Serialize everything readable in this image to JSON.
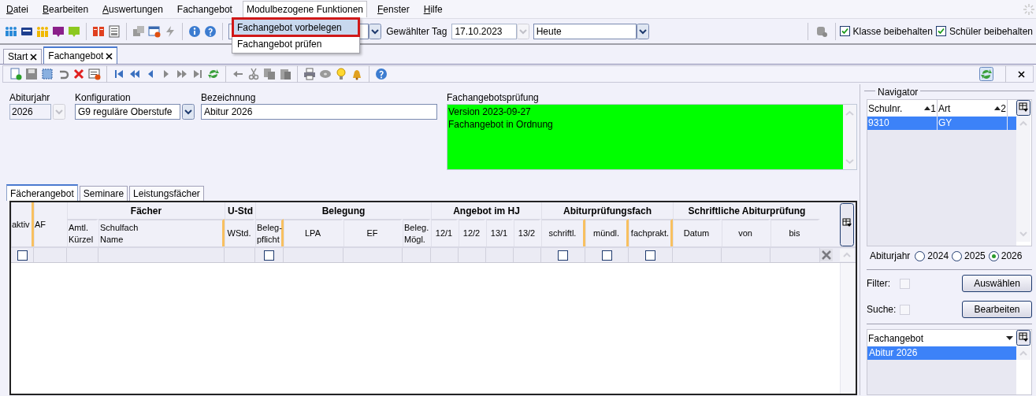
{
  "menu": [
    {
      "label": "Datei",
      "mnemonic": true,
      "selected": false
    },
    {
      "label": "Bearbeiten",
      "mnemonic": true,
      "selected": false
    },
    {
      "label": "Auswertungen",
      "mnemonic": true,
      "selected": false
    },
    {
      "label": "Fachangebot",
      "mnemonic": false,
      "selected": false
    },
    {
      "label": "Modulbezogene Funktionen",
      "mnemonic": false,
      "selected": true
    },
    {
      "label": "Fenster",
      "mnemonic": true,
      "selected": false
    },
    {
      "label": "Hilfe",
      "mnemonic": true,
      "selected": false
    }
  ],
  "dropdown": {
    "items": [
      {
        "label": "Fachangebot vorbelegen",
        "selected": true
      },
      {
        "label": "Fachangebot prüfen",
        "selected": false
      }
    ]
  },
  "toolbar": {
    "day_label": "Gewählter Tag",
    "day_value": "17.10.2023",
    "period_value": "Heute",
    "checkboxes": [
      {
        "label": "Klasse beibehalten",
        "checked": true
      },
      {
        "label": "Schüler beibehalten",
        "checked": true
      }
    ]
  },
  "tabs": [
    {
      "label": "Start",
      "selected": false
    },
    {
      "label": "Fachangebot",
      "selected": true
    }
  ],
  "form": {
    "fields": [
      {
        "label": "Abiturjahr",
        "value": "2026",
        "kind": "locked-combo"
      },
      {
        "label": "Konfiguration",
        "value": "G9 reguläre Oberstufe",
        "kind": "combo"
      },
      {
        "label": "Bezeichnung",
        "value": "Abitur 2026",
        "kind": "text"
      }
    ],
    "check": {
      "label": "Fachangebotsprüfung",
      "lines": [
        "Version 2023-09-27",
        "Fachangebot in Ordnung"
      ],
      "color": "#00ff00"
    }
  },
  "inner_tabs": [
    {
      "label": "Fächerangebot",
      "selected": true
    },
    {
      "label": "Seminare",
      "selected": false
    },
    {
      "label": "Leistungsfächer",
      "selected": false
    }
  ],
  "grid": {
    "header": [
      {
        "label": "aktiv",
        "marked": true,
        "filter_checkbox": true
      },
      {
        "label": "AF",
        "marked": false,
        "filter_checkbox": false
      },
      {
        "group": "Fächer",
        "columns": [
          {
            "label": "Amtl.\nKürzel",
            "marked": false,
            "filter_checkbox": false
          },
          {
            "label": "Schulfach\nName",
            "marked": true,
            "filter_checkbox": false
          }
        ]
      },
      {
        "group": "U-Std",
        "columns": [
          {
            "label": "WStd.",
            "marked": false,
            "filter_checkbox": false
          }
        ]
      },
      {
        "group": "Belegung",
        "columns": [
          {
            "label": "Beleg-\npflicht",
            "marked": true,
            "filter_checkbox": true
          },
          {
            "label": "LPA",
            "marked": false,
            "filter_checkbox": false
          },
          {
            "label": "EF",
            "marked": false,
            "filter_checkbox": false
          },
          {
            "label": "Beleg.\nMögl.",
            "marked": false,
            "filter_checkbox": false
          }
        ]
      },
      {
        "group": "Angebot im HJ",
        "columns": [
          {
            "label": "12/1",
            "marked": false,
            "filter_checkbox": false
          },
          {
            "label": "12/2",
            "marked": false,
            "filter_checkbox": false
          },
          {
            "label": "13/1",
            "marked": false,
            "filter_checkbox": false
          },
          {
            "label": "13/2",
            "marked": false,
            "filter_checkbox": false
          }
        ]
      },
      {
        "group": "Abiturprüfungsfach",
        "columns": [
          {
            "label": "schriftl.",
            "marked": true,
            "filter_checkbox": true
          },
          {
            "label": "mündl.",
            "marked": true,
            "filter_checkbox": true
          },
          {
            "label": "fachprakt.",
            "marked": true,
            "filter_checkbox": true
          }
        ]
      },
      {
        "group": "Schriftliche Abiturprüfung",
        "columns": [
          {
            "label": "Datum",
            "marked": false,
            "filter_checkbox": false
          },
          {
            "label": "von",
            "marked": false,
            "filter_checkbox": false
          },
          {
            "label": "bis",
            "marked": false,
            "filter_checkbox": false
          }
        ]
      }
    ]
  },
  "navigator": {
    "title": "Navigator",
    "columns": [
      {
        "label": "Schulnr.",
        "sort": "1"
      },
      {
        "label": "Art",
        "sort": "2"
      }
    ],
    "rows": [
      {
        "cells": [
          "9310",
          "GY"
        ],
        "selected": true
      }
    ],
    "year_label": "Abiturjahr",
    "years": [
      {
        "label": "2024",
        "selected": false
      },
      {
        "label": "2025",
        "selected": false
      },
      {
        "label": "2026",
        "selected": true
      }
    ],
    "filter": {
      "label": "Filter:",
      "checked": false,
      "button": "Auswählen"
    },
    "search": {
      "label": "Suche:",
      "checked": false,
      "button": "Bearbeiten"
    },
    "list": {
      "column": "Fachangebot",
      "rows": [
        {
          "label": "Abitur 2026",
          "selected": true
        }
      ]
    }
  }
}
